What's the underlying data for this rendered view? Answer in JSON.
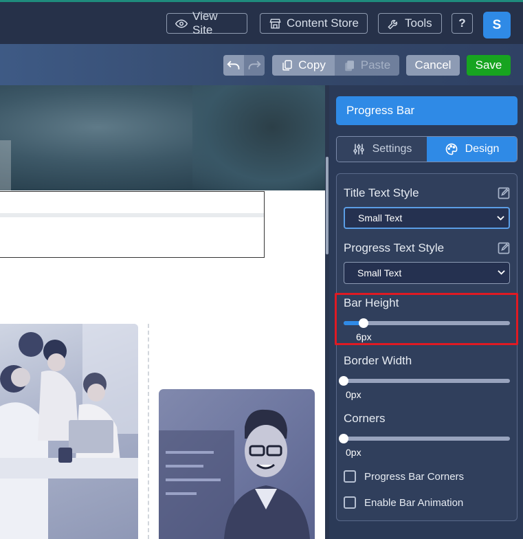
{
  "topbar": {
    "view_site": "View Site",
    "content_store": "Content Store",
    "tools": "Tools",
    "help": "?",
    "avatar_initial": "S"
  },
  "editbar": {
    "copy": "Copy",
    "paste": "Paste",
    "cancel": "Cancel",
    "save": "Save"
  },
  "panel": {
    "title": "Progress Bar",
    "tabs": {
      "settings": "Settings",
      "design": "Design"
    },
    "title_text_style": {
      "label": "Title Text Style",
      "value": "Small Text"
    },
    "progress_text_style": {
      "label": "Progress Text Style",
      "value": "Small Text"
    },
    "bar_height": {
      "label": "Bar Height",
      "value": "6px",
      "level": 0.12
    },
    "border_width": {
      "label": "Border Width",
      "value": "0px",
      "level": 0
    },
    "corners": {
      "label": "Corners",
      "value": "0px",
      "level": 0
    },
    "progress_bar_corners": {
      "label": "Progress Bar Corners",
      "checked": false
    },
    "enable_bar_animation": {
      "label": "Enable Bar Animation",
      "checked": false
    }
  },
  "colors": {
    "accent": "#2f8ae6",
    "save": "#17a420",
    "highlight": "#e01a23",
    "topbar": "#263149"
  }
}
